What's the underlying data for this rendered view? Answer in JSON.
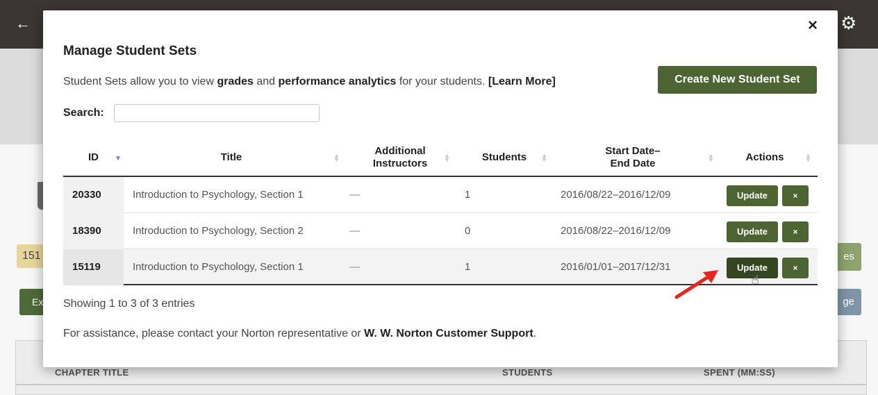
{
  "background": {
    "badge_text": "151",
    "left_button_text": "Ex",
    "right_button1_text": "es",
    "right_button2_text": "ge",
    "table_columns": [
      "CHAPTER TITLE",
      "STUDENTS",
      "SPENT (MM:SS)"
    ]
  },
  "modal": {
    "title": "Manage Student Sets",
    "intro": {
      "prefix": "Student Sets allow you to view ",
      "bold1": "grades",
      "middle": " and ",
      "bold2": "performance analytics",
      "suffix": " for your students. ",
      "learn_more": "[Learn More]"
    },
    "create_button": "Create New Student Set",
    "search": {
      "label": "Search:",
      "value": "",
      "placeholder": ""
    },
    "table": {
      "columns": [
        "ID",
        "Title",
        "Additional Instructors",
        "Students",
        "Start Date– End Date",
        "Actions"
      ],
      "rows": [
        {
          "id": "20330",
          "title": "Introduction to Psychology, Section 1",
          "instructors": "—",
          "students": "1",
          "dates": "2016/08/22–2016/12/09",
          "update": "Update",
          "delete": "×"
        },
        {
          "id": "18390",
          "title": "Introduction to Psychology, Section 2",
          "instructors": "—",
          "students": "0",
          "dates": "2016/08/22–2016/12/09",
          "update": "Update",
          "delete": "×"
        },
        {
          "id": "15119",
          "title": "Introduction to Psychology, Section 1",
          "instructors": "—",
          "students": "1",
          "dates": "2016/01/01–2017/12/31",
          "update": "Update",
          "delete": "×"
        }
      ]
    },
    "showing": "Showing 1 to 3 of 3 entries",
    "assist": {
      "prefix": "For assistance, please contact your Norton representative or ",
      "link": "W. W. Norton Customer Support",
      "suffix": "."
    },
    "close_label": "×"
  },
  "colors": {
    "header": "#3a3632",
    "primary_button": "#4b6432",
    "annotation_arrow": "#e8261c"
  },
  "icons": {
    "back": "arrow-left-icon",
    "settings": "gears-icon",
    "close": "close-icon",
    "sort": "sort-icon",
    "cursor": "hand-pointer-icon"
  }
}
